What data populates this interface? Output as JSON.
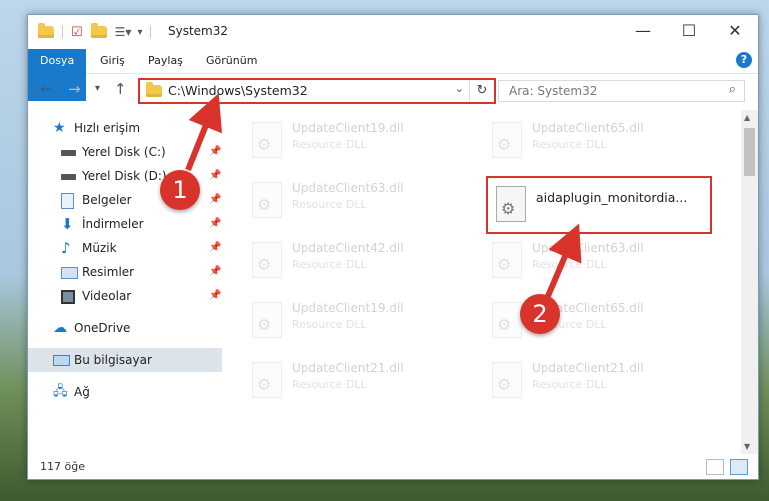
{
  "window": {
    "title": "System32",
    "controls": {
      "minimize": "—",
      "maximize": "☐",
      "close": "✕"
    }
  },
  "ribbon": {
    "tabs": [
      "Dosya",
      "Giriş",
      "Paylaş",
      "Görünüm"
    ],
    "help": "?"
  },
  "navigation": {
    "address": "C:\\Windows\\System32",
    "search_placeholder": "Ara: System32"
  },
  "sidebar": {
    "quick_access": "Hızlı erişim",
    "items": [
      {
        "label": "Yerel Disk (C:)",
        "icon": "drive-icon"
      },
      {
        "label": "Yerel Disk (D:)",
        "icon": "drive-icon"
      },
      {
        "label": "Belgeler",
        "icon": "documents-icon"
      },
      {
        "label": "İndirmeler",
        "icon": "downloads-icon"
      },
      {
        "label": "Müzik",
        "icon": "music-icon"
      },
      {
        "label": "Resimler",
        "icon": "pictures-icon"
      },
      {
        "label": "Videolar",
        "icon": "videos-icon"
      }
    ],
    "onedrive": "OneDrive",
    "this_pc": "Bu bilgisayar",
    "network": "Ağ"
  },
  "files": {
    "left": [
      {
        "name": "UpdateClient19.dll",
        "type": "Resource DLL"
      },
      {
        "name": "UpdateClient63.dll",
        "type": "Resource DLL"
      },
      {
        "name": "UpdateClient42.dll",
        "type": "Resource DLL"
      },
      {
        "name": "UpdateClient19.dll",
        "type": "Resource DLL"
      },
      {
        "name": "UpdateClient21.dll",
        "type": "Resource DLL"
      }
    ],
    "right": [
      {
        "name": "UpdateClient65.dll",
        "type": "Resource DLL"
      },
      {
        "name": "UpdateClient63.dll",
        "type": "Resource DLL"
      },
      {
        "name": "UpdateClient65.dll",
        "type": "Resource DLL"
      },
      {
        "name": "UpdateClient21.dll",
        "type": "Resource DLL"
      }
    ],
    "target": {
      "name": "aidaplugin_monitordia..."
    }
  },
  "status": {
    "count": "117 öğe"
  },
  "annotations": {
    "step1": "1",
    "step2": "2",
    "color": "#d9342b"
  }
}
